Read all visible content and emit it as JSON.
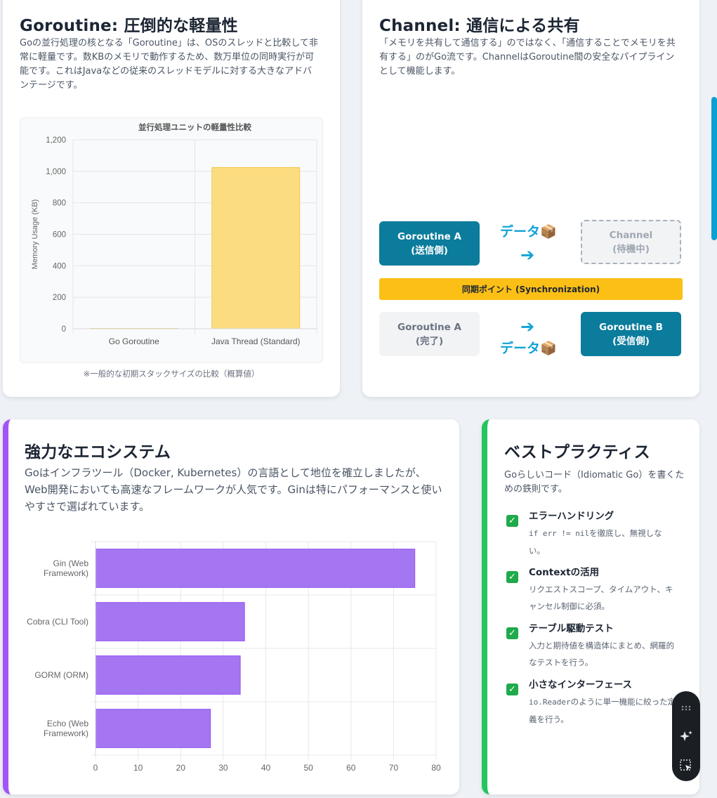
{
  "goroutine_card": {
    "title": "Goroutine: 圧倒的な軽量性",
    "description": "Goの並行処理の核となる「Goroutine」は、OSのスレッドと比較して非常に軽量です。数KBのメモリで動作するため、数万単位の同時実行が可能です。これはJavaなどの従来のスレッドモデルに対する大きなアドバンテージです。",
    "note": "※一般的な初期スタックサイズの比較（概算値）"
  },
  "channel_card": {
    "title": "Channel: 通信による共有",
    "description": "「メモリを共有して通信する」のではなく、「通信することでメモリを共有する」のがGo流です。ChannelはGoroutine間の安全なパイプラインとして機能します。",
    "sender": {
      "line1": "Goroutine A",
      "line2": "(送信側)"
    },
    "channel": {
      "line1": "Channel",
      "line2": "(待機中)"
    },
    "done": {
      "line1": "Goroutine A",
      "line2": "(完了)"
    },
    "receiver": {
      "line1": "Goroutine B",
      "line2": "(受信側)"
    },
    "data_label_top": "データ📦",
    "data_label_bottom": "データ📦",
    "arrow": "➔",
    "sync_label": "同期ポイント (Synchronization)"
  },
  "ecosystem_card": {
    "title": "強力なエコシステム",
    "description": "Goはインフラツール（Docker, Kubernetes）の言語として地位を確立しましたが、Web開発においても高速なフレームワークが人気です。Ginは特にパフォーマンスと使いやすさで選ばれています。"
  },
  "best_card": {
    "title": "ベストプラクティス",
    "description": "Goらしいコード（Idiomatic Go）を書くための鉄則です。",
    "tips": [
      {
        "title": "エラーハンドリング",
        "code": "if err != nil",
        "text": "を徹底し、無視しない。"
      },
      {
        "title": "Contextの活用",
        "code": "",
        "text": "リクエストスコープ、タイムアウト、キャンセル制御に必須。"
      },
      {
        "title": "テーブル駆動テスト",
        "code": "",
        "text": "入力と期待値を構造体にまとめ、網羅的なテストを行う。"
      },
      {
        "title": "小さなインターフェース",
        "code": "io.Reader",
        "text": "のように単一機能に絞った定義を行う。"
      }
    ],
    "check_icon": "✓"
  },
  "colors": {
    "accent_blue": "#0b7c9c",
    "accent_purple": "#a355f7",
    "accent_green": "#22c55e",
    "sync_yellow": "#fbbf15",
    "memory_bar": "#fcdc80",
    "eco_bar": "#a576f2"
  },
  "toolbar": {
    "icons": [
      "drag-handle-icon",
      "sparkle-icon",
      "select-cursor-icon"
    ]
  },
  "chart_data": [
    {
      "type": "bar",
      "title": "並行処理ユニットの軽量性比較",
      "categories": [
        "Go Goroutine",
        "Java Thread (Standard)"
      ],
      "values": [
        2,
        1024
      ],
      "xlabel": "",
      "ylabel": "Memory Usage (KB)",
      "ylim": [
        0,
        1200
      ],
      "yticks": [
        "0",
        "200",
        "400",
        "600",
        "800",
        "1,000",
        "1,200"
      ],
      "grid": true,
      "legend": "none"
    },
    {
      "type": "bar",
      "orientation": "horizontal",
      "title": "",
      "categories": [
        [
          "Gin (Web",
          "Framework)"
        ],
        [
          "Cobra (CLI Tool)"
        ],
        [
          "GORM (ORM)"
        ],
        [
          "Echo (Web",
          "Framework)"
        ]
      ],
      "values": [
        75,
        35,
        34,
        27
      ],
      "xlabel": "",
      "ylabel": "",
      "xlim": [
        0,
        80
      ],
      "xticks": [
        "0",
        "10",
        "20",
        "30",
        "40",
        "50",
        "60",
        "70",
        "80"
      ],
      "grid": true,
      "legend": "none"
    }
  ]
}
